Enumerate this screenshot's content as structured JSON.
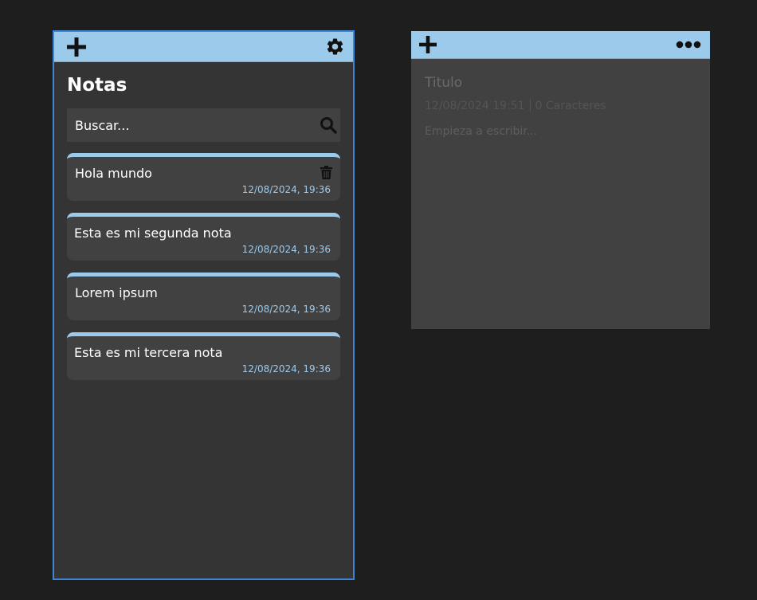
{
  "list_panel": {
    "header": {
      "add_icon": "plus-icon",
      "settings_icon": "gear-icon"
    },
    "title": "Notas",
    "search": {
      "placeholder": "Buscar...",
      "icon": "search-icon"
    },
    "notes": [
      {
        "title": "Hola mundo",
        "date": "12/08/2024, 19:36",
        "has_delete": true
      },
      {
        "title": "Esta es mi segunda nota",
        "date": "12/08/2024, 19:36",
        "has_delete": false
      },
      {
        "title": "Lorem ipsum",
        "date": "12/08/2024, 19:36",
        "has_delete": false
      },
      {
        "title": "Esta es mi tercera nota",
        "date": "12/08/2024, 19:36",
        "has_delete": false
      }
    ]
  },
  "editor_panel": {
    "header": {
      "add_icon": "plus-icon",
      "more_icon": "more-horizontal-icon"
    },
    "title_placeholder": "Titulo",
    "meta_date": "12/08/2024 19:51",
    "meta_chars": "0 Caracteres",
    "body_placeholder": "Empieza a escribir..."
  },
  "colors": {
    "background": "#1e1e1e",
    "panel": "#353435",
    "card": "#424142",
    "accent": "#9ccaeb",
    "selection_border": "#3d86d6"
  }
}
